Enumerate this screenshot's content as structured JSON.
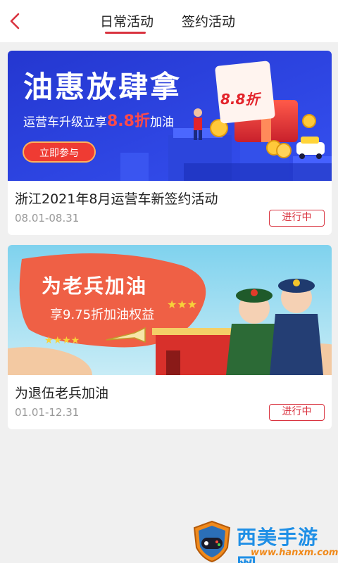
{
  "header": {
    "tabs": [
      {
        "label": "日常活动",
        "active": true
      },
      {
        "label": "签约活动",
        "active": false
      }
    ]
  },
  "activities": [
    {
      "title": "浙江2021年8月运营车新签约活动",
      "date_range": "08.01-08.31",
      "status": "进行中",
      "banner": {
        "headline": "油惠放肆拿",
        "sub_prefix": "运营车升级立享",
        "sub_highlight": "8.8折",
        "sub_suffix": "加油",
        "button": "立即参与",
        "ticket": "8.8折"
      }
    },
    {
      "title": "为退伍老兵加油",
      "date_range": "01.01-12.31",
      "status": "进行中",
      "banner": {
        "headline": "为老兵加油",
        "sub": "享9.75折加油权益"
      }
    }
  ],
  "watermark": {
    "name": "西美手游网",
    "url": "www.hanxm.com"
  },
  "colors": {
    "accent": "#d9333f",
    "banner1_bg": "#2a3fd6",
    "banner2_flag": "#ef6045",
    "watermark_blue": "#1f8fe6",
    "watermark_orange": "#f08a1c"
  }
}
